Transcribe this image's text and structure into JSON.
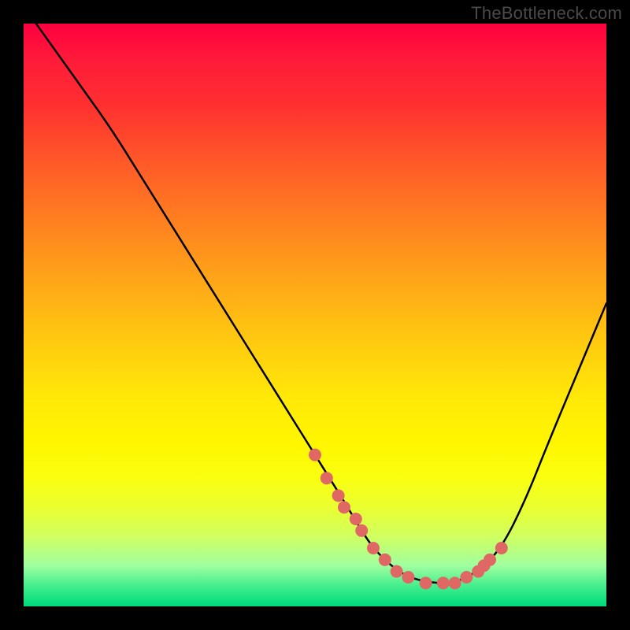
{
  "watermark": "TheBottleneck.com",
  "chart_data": {
    "type": "line",
    "title": "",
    "xlabel": "",
    "ylabel": "",
    "xlim": [
      0,
      100
    ],
    "ylim": [
      0,
      100
    ],
    "grid": false,
    "legend": false,
    "series": [
      {
        "name": "bottleneck-curve",
        "x": [
          0,
          5,
          10,
          15,
          20,
          25,
          30,
          35,
          40,
          45,
          50,
          55,
          58,
          60,
          63,
          66,
          70,
          74,
          78,
          82,
          86,
          90,
          95,
          100
        ],
        "y": [
          103,
          96,
          89,
          82,
          74,
          66,
          58,
          50,
          42,
          34,
          26,
          18,
          13,
          10,
          7,
          5,
          4,
          4,
          6,
          10,
          18,
          28,
          40,
          52
        ]
      }
    ],
    "markers": {
      "name": "highlight-points",
      "color": "#e06864",
      "radius_px": 8,
      "x": [
        50,
        52,
        54,
        55,
        57,
        58,
        60,
        62,
        64,
        66,
        69,
        72,
        74,
        76,
        78,
        79,
        80,
        82
      ],
      "y": [
        26,
        22,
        19,
        17,
        15,
        13,
        10,
        8,
        6,
        5,
        4,
        4,
        4,
        5,
        6,
        7,
        8,
        10
      ]
    }
  }
}
